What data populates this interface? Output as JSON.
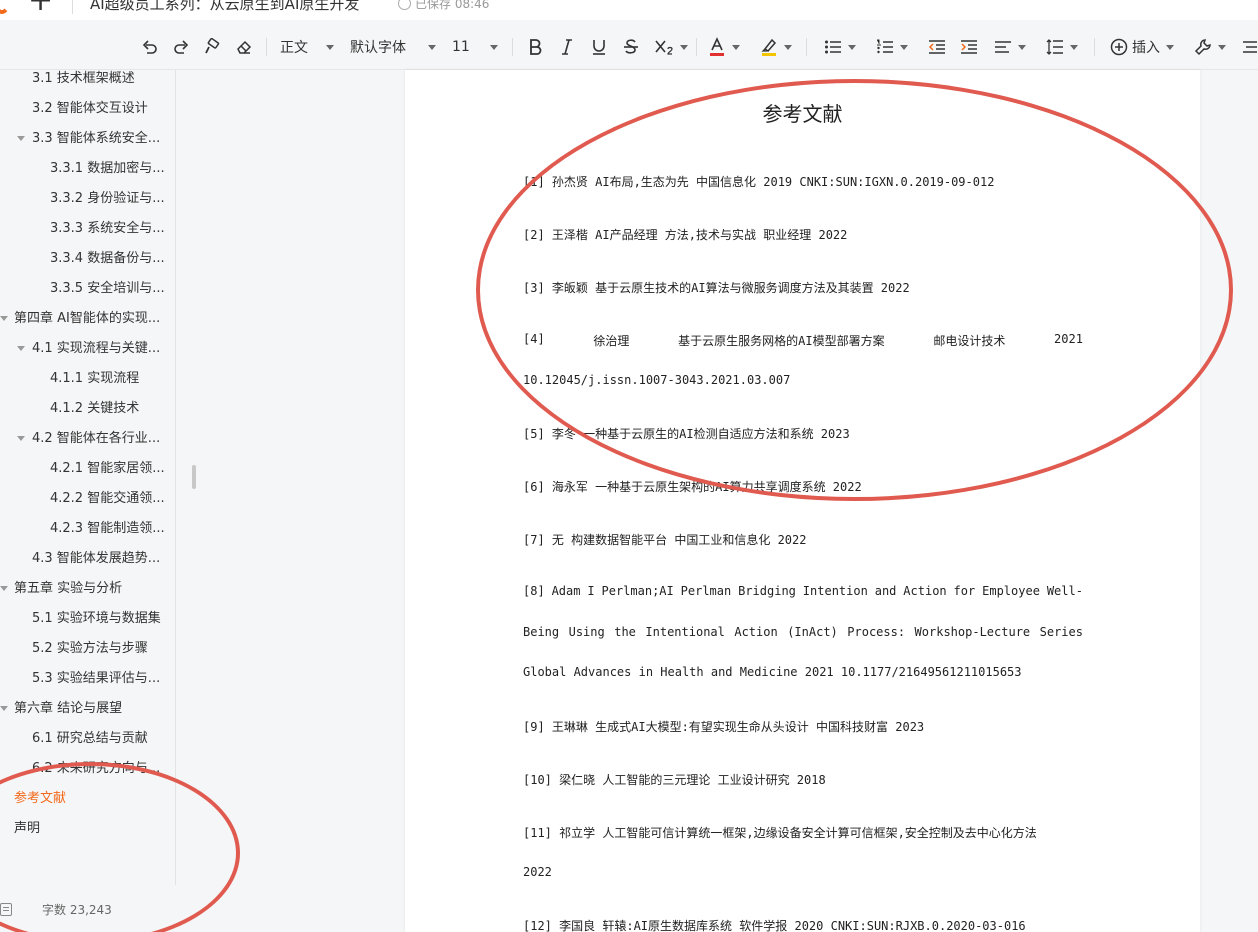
{
  "app": {
    "doc_title": "AI超级员工系列：从云原生到AI原生开发",
    "saved_status": "已保存 08:46",
    "plus": "+"
  },
  "toolbar": {
    "style": "正文",
    "font": "默认字体",
    "size": "11",
    "insert": "插入"
  },
  "outline": [
    {
      "label": "3.1 技术框架概述",
      "level": 2
    },
    {
      "label": "3.2 智能体交互设计",
      "level": 2
    },
    {
      "label": "3.3 智能体系统安全...",
      "level": 2,
      "expanded": true
    },
    {
      "label": "3.3.1 数据加密与...",
      "level": 3
    },
    {
      "label": "3.3.2 身份验证与...",
      "level": 3
    },
    {
      "label": "3.3.3 系统安全与...",
      "level": 3
    },
    {
      "label": "3.3.4 数据备份与...",
      "level": 3
    },
    {
      "label": "3.3.5 安全培训与...",
      "level": 3
    },
    {
      "label": "第四章 AI智能体的实现...",
      "level": 1,
      "expanded": true
    },
    {
      "label": "4.1 实现流程与关键...",
      "level": 2,
      "expanded": true
    },
    {
      "label": "4.1.1 实现流程",
      "level": 3
    },
    {
      "label": "4.1.2 关键技术",
      "level": 3
    },
    {
      "label": "4.2 智能体在各行业...",
      "level": 2,
      "expanded": true
    },
    {
      "label": "4.2.1 智能家居领...",
      "level": 3
    },
    {
      "label": "4.2.2 智能交通领...",
      "level": 3
    },
    {
      "label": "4.2.3 智能制造领...",
      "level": 3
    },
    {
      "label": "4.3 智能体发展趋势...",
      "level": 2
    },
    {
      "label": "第五章 实验与分析",
      "level": 1,
      "expanded": true
    },
    {
      "label": "5.1 实验环境与数据集",
      "level": 2
    },
    {
      "label": "5.2 实验方法与步骤",
      "level": 2
    },
    {
      "label": "5.3 实验结果评估与...",
      "level": 2
    },
    {
      "label": "第六章 结论与展望",
      "level": 1,
      "expanded": true
    },
    {
      "label": "6.1 研究总结与贡献",
      "level": 2
    },
    {
      "label": "6.2 未来研究方向与...",
      "level": 2
    },
    {
      "label": "参考文献",
      "level": 1,
      "active": true
    },
    {
      "label": "声明",
      "level": 1
    }
  ],
  "status": {
    "word_count": "字数 23,243"
  },
  "page": {
    "heading": "参考文献",
    "references": [
      {
        "lines": [
          "[1] 孙杰贤 AI布局,生态为先 中国信息化 2019 CNKI:SUN:IGXN.0.2019-09-012"
        ]
      },
      {
        "lines": [
          "[2] 王泽楷 AI产品经理 方法,技术与实战 职业经理 2022"
        ]
      },
      {
        "lines": [
          "[3] 李皈颖 基于云原生技术的AI算法与微服务调度方法及其装置 2022"
        ]
      },
      {
        "lines": [
          "[4] 徐治理 基于云原生服务网格的AI模型部署方案 邮电设计技术 2021",
          "10.12045/j.issn.1007-3043.2021.03.007"
        ],
        "justify": [
          true,
          false
        ]
      },
      {
        "lines": [
          "[5] 李冬 一种基于云原生的AI检测自适应方法和系统 2023"
        ]
      },
      {
        "lines": [
          "[6] 海永军 一种基于云原生架构的AI算力共享调度系统 2022"
        ]
      },
      {
        "lines": [
          "[7] 无 构建数据智能平台 中国工业和信息化 2022"
        ]
      },
      {
        "lines": [
          "[8] Adam I Perlman;AI Perlman Bridging Intention and Action for Employee Well-",
          "Being Using the Intentional Action (InAct) Process: Workshop-Lecture Series",
          "Global Advances in Health and Medicine 2021 10.1177/21649561211015653"
        ],
        "justify": [
          true,
          true,
          false
        ]
      },
      {
        "lines": [
          "[9] 王琳琳 生成式AI大模型:有望实现生命从头设计 中国科技财富 2023"
        ]
      },
      {
        "lines": [
          "[10] 梁仁晓 人工智能的三元理论 工业设计研究 2018"
        ]
      },
      {
        "lines": [
          "[11] 祁立学 人工智能可信计算统一框架,边缘设备安全计算可信框架,安全控制及去中心化方法",
          "2022"
        ]
      },
      {
        "lines": [
          "[12] 李国良 轩辕:AI原生数据库系统 软件学报 2020 CNKI:SUN:RJXB.0.2020-03-016"
        ]
      }
    ]
  },
  "colors": {
    "accent": "#f26b1d",
    "annotation": "#e05a4f",
    "font_color_bar": "#e03030",
    "highlight_bar": "#f5c400"
  }
}
